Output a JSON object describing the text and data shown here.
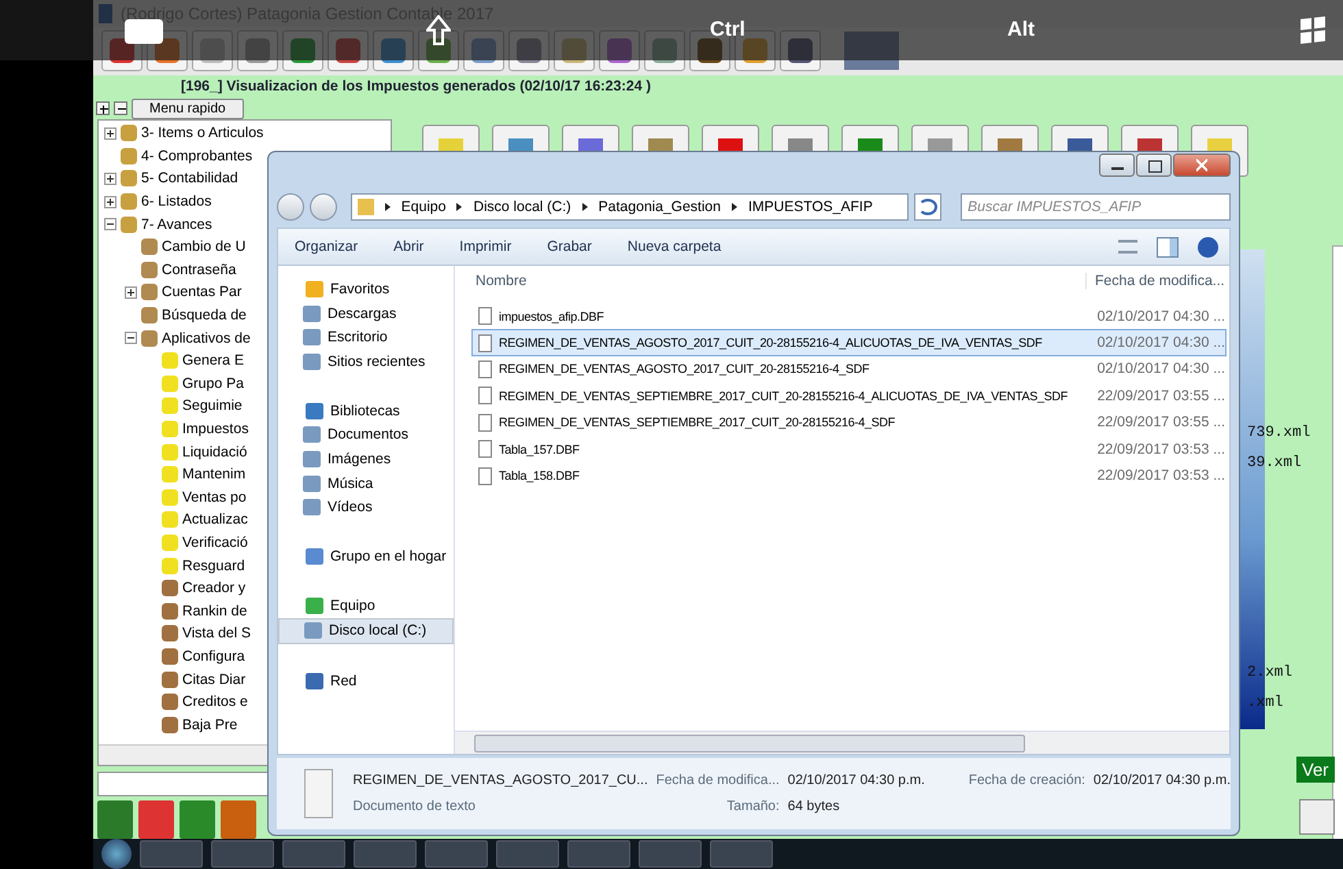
{
  "overlay_bar": {
    "keys": [
      "Ctrl",
      "Alt"
    ]
  },
  "app": {
    "title": "(Rodrigo Cortes) Patagonia Gestion Contable 2017",
    "form_title": "[196_] Visualizacion de los Impuestos generados (02/10/17 16:23:24  )",
    "quick_menu": "Menu rapido",
    "tree": [
      {
        "label": "3- Items o Articulos",
        "expanded": false
      },
      {
        "label": "4- Comprobantes"
      },
      {
        "label": "5- Contabilidad",
        "expanded": false
      },
      {
        "label": "6- Listados",
        "expanded": false
      },
      {
        "label": "7- Avances",
        "expanded": true,
        "children": [
          {
            "label": "Cambio de U"
          },
          {
            "label": "Contraseña"
          },
          {
            "label": "Cuentas Par",
            "expanded": false
          },
          {
            "label": "Búsqueda de"
          },
          {
            "label": "Aplicativos de",
            "expanded": true,
            "children": [
              {
                "label": "Genera E"
              },
              {
                "label": "Grupo Pa"
              },
              {
                "label": "Seguimie"
              },
              {
                "label": "Impuestos"
              },
              {
                "label": "Liquidació"
              },
              {
                "label": "Mantenim"
              },
              {
                "label": "Ventas po"
              },
              {
                "label": "Actualizac"
              },
              {
                "label": "Verificació"
              },
              {
                "label": "Resguard"
              },
              {
                "label": "Creador y"
              },
              {
                "label": "Rankin de"
              },
              {
                "label": "Vista del S"
              },
              {
                "label": "Configura"
              },
              {
                "label": "Citas Diar"
              },
              {
                "label": "Creditos e"
              },
              {
                "label": "Baja Pre"
              }
            ]
          }
        ]
      }
    ],
    "background_files": [
      "739.xml",
      "39.xml",
      "2.xml",
      ".xml"
    ],
    "view_button": "Ver"
  },
  "explorer": {
    "breadcrumb": [
      "Equipo",
      "Disco local (C:)",
      "Patagonia_Gestion",
      "IMPUESTOS_AFIP"
    ],
    "search": {
      "placeholder": "Buscar IMPUESTOS_AFIP"
    },
    "commands": [
      "Organizar",
      "Abrir",
      "Imprimir",
      "Grabar",
      "Nueva carpeta"
    ],
    "nav": [
      {
        "label": "Favoritos",
        "children": [
          {
            "label": "Descargas",
            "selected": false
          },
          {
            "label": "Escritorio",
            "selected": false
          },
          {
            "label": "Sitios recientes",
            "selected": false
          }
        ]
      },
      {
        "label": "Bibliotecas",
        "children": [
          {
            "label": "Documentos",
            "selected": false
          },
          {
            "label": "Imágenes",
            "selected": false
          },
          {
            "label": "Música",
            "selected": false
          },
          {
            "label": "Vídeos",
            "selected": false
          }
        ]
      },
      {
        "label": "Grupo en el hogar"
      },
      {
        "label": "Equipo",
        "children": [
          {
            "label": "Disco local (C:)",
            "selected": true
          }
        ]
      },
      {
        "label": "Red"
      }
    ],
    "columns": [
      "Nombre",
      "Fecha de modifica..."
    ],
    "files": [
      {
        "name": "impuestos_afip.DBF",
        "date": "02/10/2017 04:30 ...",
        "selected": false
      },
      {
        "name": "REGIMEN_DE_VENTAS_AGOSTO_2017_CUIT_20-28155216-4_ALICUOTAS_DE_IVA_VENTAS_SDF",
        "date": "02/10/2017 04:30 ...",
        "selected": true
      },
      {
        "name": "REGIMEN_DE_VENTAS_AGOSTO_2017_CUIT_20-28155216-4_SDF",
        "date": "02/10/2017 04:30 ...",
        "selected": false
      },
      {
        "name": "REGIMEN_DE_VENTAS_SEPTIEMBRE_2017_CUIT_20-28155216-4_ALICUOTAS_DE_IVA_VENTAS_SDF",
        "date": "22/09/2017 03:55 ...",
        "selected": false
      },
      {
        "name": "REGIMEN_DE_VENTAS_SEPTIEMBRE_2017_CUIT_20-28155216-4_SDF",
        "date": "22/09/2017 03:55 ...",
        "selected": false
      },
      {
        "name": "Tabla_157.DBF",
        "date": "22/09/2017 03:53 ...",
        "selected": false
      },
      {
        "name": "Tabla_158.DBF",
        "date": "22/09/2017 03:53 ...",
        "selected": false
      }
    ],
    "details": {
      "name": "REGIMEN_DE_VENTAS_AGOSTO_2017_CU...",
      "type": "Documento de texto",
      "modified_label": "Fecha de modifica...",
      "modified": "02/10/2017 04:30 p.m.",
      "size_label": "Tamaño:",
      "size": "64 bytes",
      "created_label": "Fecha de creación:",
      "created": "02/10/2017 04:30 p.m."
    }
  }
}
